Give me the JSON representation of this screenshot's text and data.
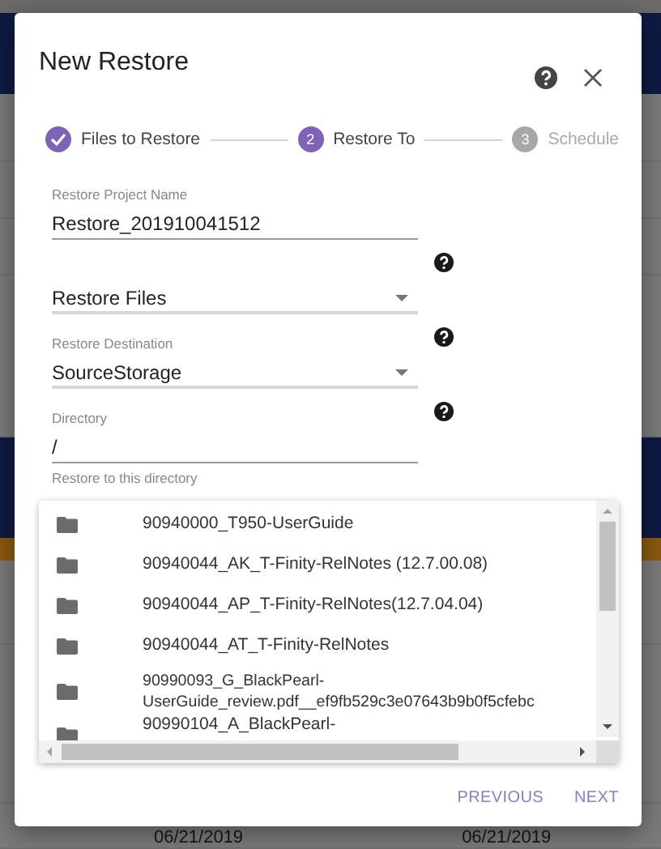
{
  "background_page": {
    "bands": [
      {
        "kind": "top"
      },
      {
        "kind": "navy"
      },
      {
        "kind": "gray"
      },
      {
        "kind": "gray"
      },
      {
        "kind": "gray"
      },
      {
        "kind": "gray"
      },
      {
        "kind": "navy"
      },
      {
        "kind": "orange"
      },
      {
        "kind": "gray"
      },
      {
        "kind": "gray"
      },
      {
        "kind": "footer",
        "dates": [
          "06/21/2019",
          "06/21/2019"
        ]
      }
    ]
  },
  "dialog": {
    "title": "New Restore",
    "steps": [
      {
        "label": "Files to Restore",
        "completed": true,
        "enabled": true
      },
      {
        "label": "Restore To",
        "number": "2",
        "completed": false,
        "enabled": true
      },
      {
        "label": "Schedule",
        "number": "3",
        "completed": false,
        "enabled": false
      }
    ],
    "fields": [
      {
        "kind": "text",
        "label": "Restore Project Name",
        "value": "Restore_201910041512",
        "help": false
      },
      {
        "kind": "select",
        "value": "Restore Files",
        "help": true
      },
      {
        "kind": "select",
        "label": "Restore Destination",
        "value": "SourceStorage",
        "help": true
      },
      {
        "kind": "text",
        "label": "Directory",
        "value": "/",
        "hint": "Restore to this directory",
        "help": true
      }
    ],
    "folders": [
      {
        "name": "90940000_T950-UserGuide"
      },
      {
        "name": "90940044_AK_T-Finity-RelNotes (12.7.00.08)"
      },
      {
        "name": "90940044_AP_T-Finity-RelNotes(12.7.04.04)"
      },
      {
        "name": "90940044_AT_T-Finity-RelNotes"
      },
      {
        "name": "90990093_G_BlackPearl-UserGuide_review.pdf__ef9fb529c3e07643b9b0f5cfebc"
      },
      {
        "name": "90990104_A_BlackPearl-"
      }
    ],
    "buttons": [
      {
        "label": "PREVIOUS"
      },
      {
        "label": "NEXT"
      }
    ]
  }
}
